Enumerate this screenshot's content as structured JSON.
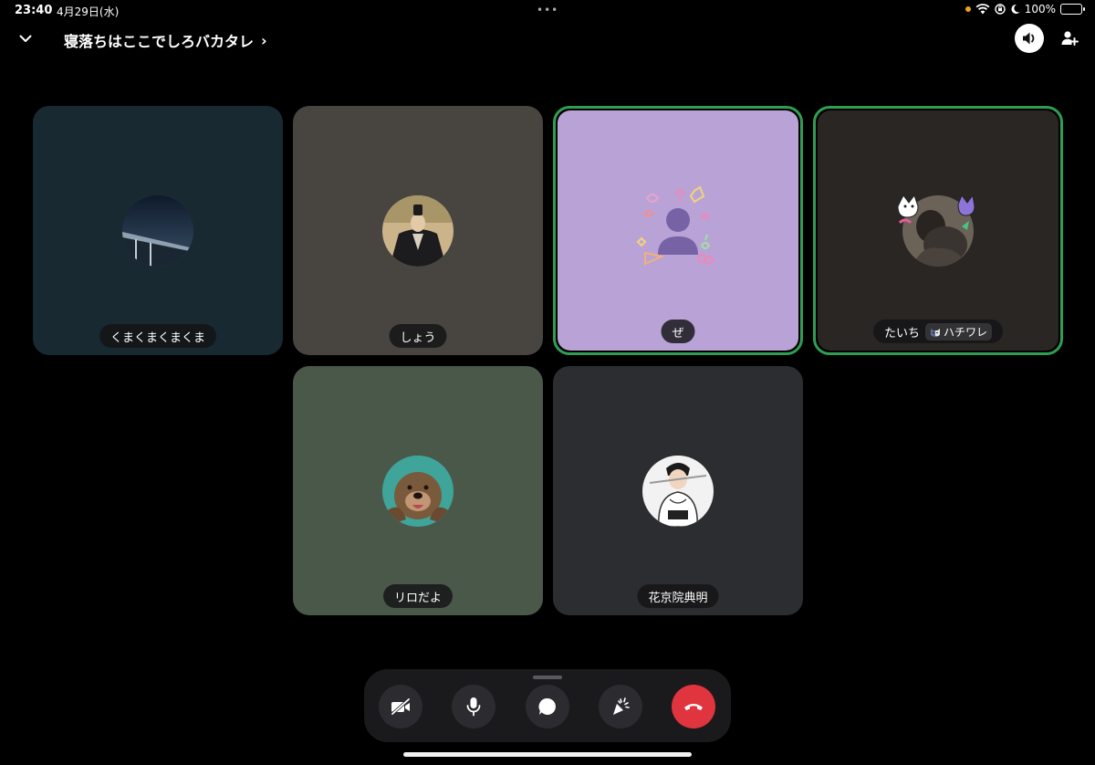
{
  "status_bar": {
    "time": "23:40",
    "date": "4月29日(水)",
    "battery": "100%"
  },
  "header": {
    "channel_title": "寝落ちはここでしろバカタレ",
    "chevron": "›"
  },
  "participants": [
    {
      "name": "くまくまくまくま",
      "speaking": false,
      "bg": "#182931"
    },
    {
      "name": "しょう",
      "speaking": false,
      "bg": "#484440"
    },
    {
      "name": "ぜ",
      "speaking": true,
      "bg": "#b9a3d6"
    },
    {
      "name": "たいち",
      "tag": "ハチワレ",
      "speaking": true,
      "bg": "#2a2623"
    },
    {
      "name": "リロだよ",
      "speaking": false,
      "bg": "#4a584a"
    },
    {
      "name": "花京院典明",
      "speaking": false,
      "bg": "#2c2d31"
    }
  ],
  "controls": [
    {
      "icon": "camera-off-icon"
    },
    {
      "icon": "microphone-icon"
    },
    {
      "icon": "chat-bubble-icon"
    },
    {
      "icon": "activity-party-icon"
    },
    {
      "icon": "end-call-icon"
    }
  ],
  "colors": {
    "speaking_border": "#2f9e53",
    "end_call": "#e0343e",
    "battery_charging": "#3ed158"
  }
}
